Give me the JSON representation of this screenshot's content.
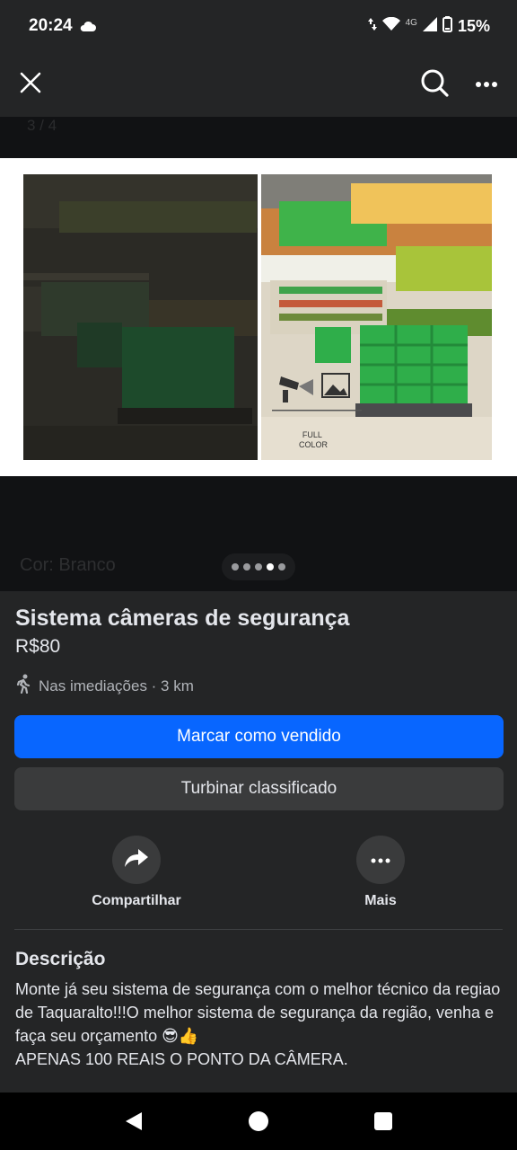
{
  "status_bar": {
    "time": "20:24",
    "network": "4G",
    "battery": "15%",
    "icons": [
      "cloud-icon",
      "data-arrows-icon",
      "wifi-icon",
      "signal-icon",
      "battery-icon"
    ]
  },
  "top_bar": {
    "icons": [
      "close-icon",
      "search-icon",
      "more-icon"
    ]
  },
  "media": {
    "ghost_counter": "3 / 4",
    "ghost_caption": "Cor: Branco",
    "photo_caption": "FULL\nCOLOR",
    "dots": {
      "total": 5,
      "active_index": 3
    }
  },
  "listing": {
    "title": "Sistema câmeras de segurança",
    "price": "R$80",
    "location": "Nas imediações · 3 km",
    "primary_button": "Marcar como vendido",
    "secondary_button": "Turbinar classificado",
    "share_label": "Compartilhar",
    "more_label": "Mais",
    "description_heading": "Descrição",
    "description": "Monte já seu sistema de segurança com o melhor técnico da regiao de Taquaralto!!!O melhor sistema de segurança da região, venha e faça seu orçamento 😎👍\nAPENAS 100 REAIS O PONTO DA CÂMERA."
  },
  "colors": {
    "primary_button": "#0866ff",
    "secondary_button": "#3a3b3c",
    "background": "#242526",
    "produce_green": "#2fae4a"
  },
  "nav": {
    "icons": [
      "back-icon",
      "home-icon",
      "recents-icon"
    ]
  }
}
